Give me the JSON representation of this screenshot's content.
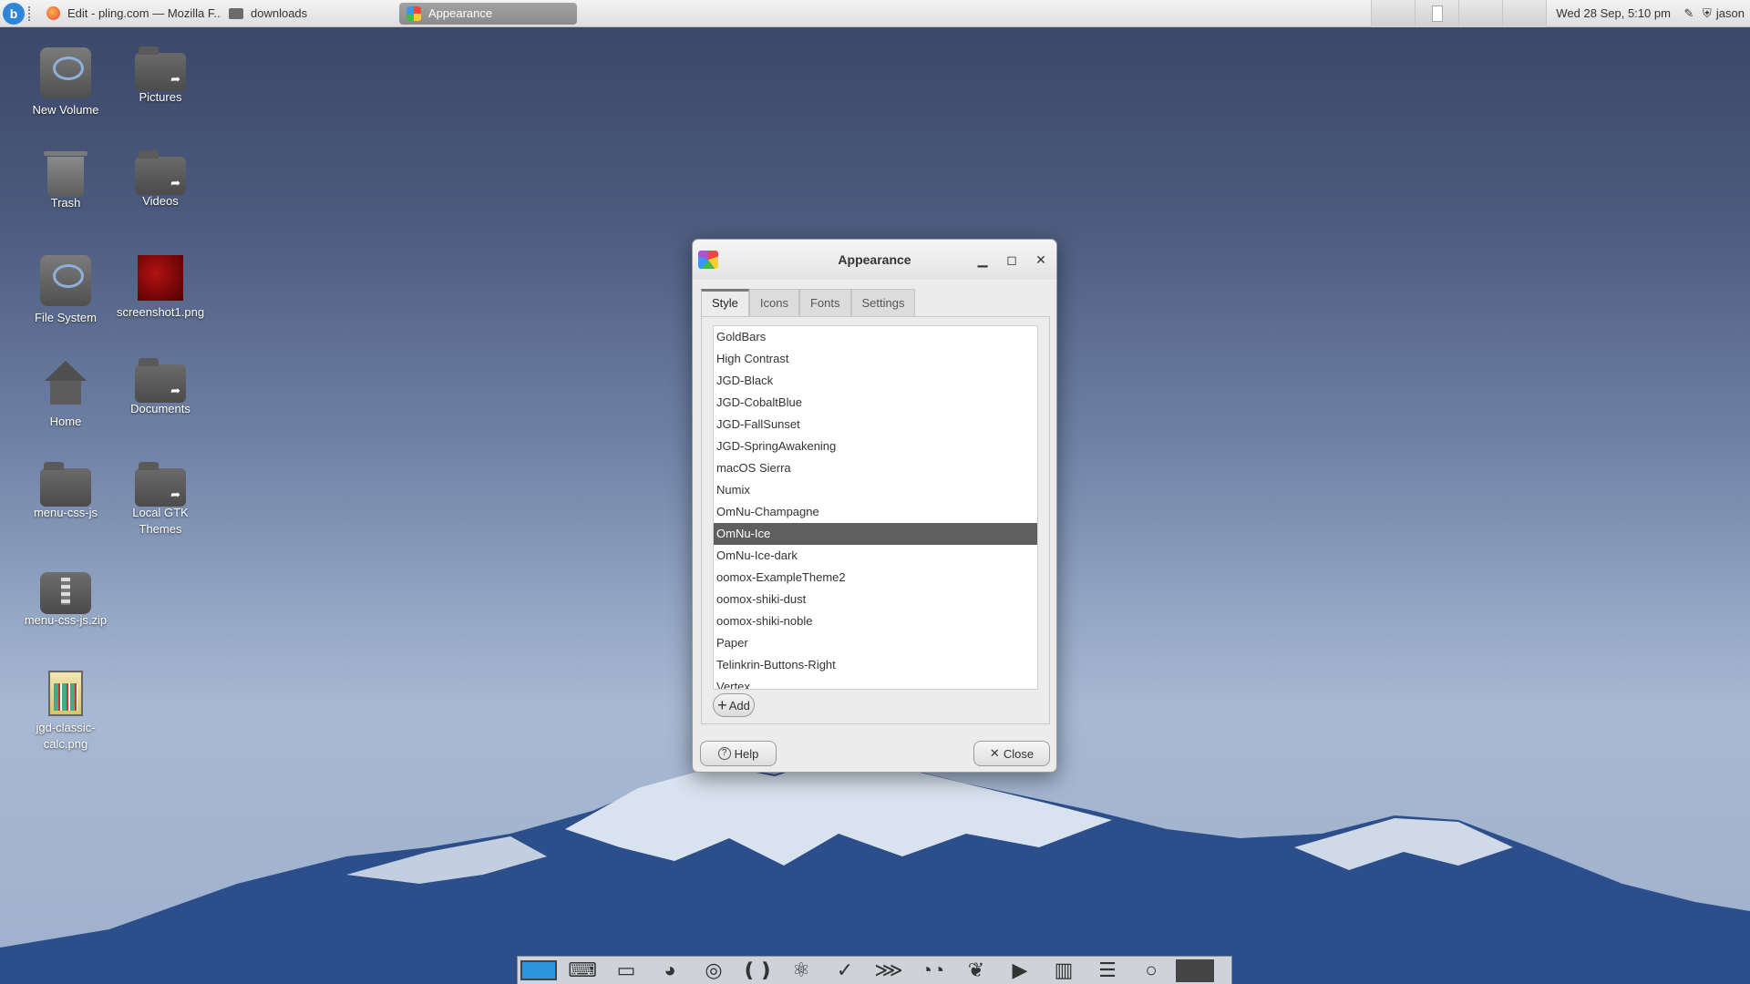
{
  "top_panel": {
    "tasks": [
      {
        "label": "Edit - pling.com — Mozilla F..."
      },
      {
        "label": "downloads"
      },
      {
        "label": "Appearance"
      }
    ],
    "clock": "Wed 28 Sep, 5:10 pm",
    "user": "jason"
  },
  "desktop": {
    "icons": [
      {
        "label": "New Volume",
        "icon": "drive-icon"
      },
      {
        "label": "Pictures",
        "icon": "folder-link-icon"
      },
      {
        "label": "Trash",
        "icon": "trash-icon"
      },
      {
        "label": "Videos",
        "icon": "folder-link-icon"
      },
      {
        "label": "File System",
        "icon": "drive-icon"
      },
      {
        "label": "screenshot1.png",
        "icon": "image-icon"
      },
      {
        "label": "Home",
        "icon": "home-icon"
      },
      {
        "label": "Documents",
        "icon": "folder-link-icon"
      },
      {
        "label": "menu-css-js",
        "icon": "folder-icon"
      },
      {
        "label": "Local GTK Themes",
        "icon": "folder-link-icon"
      },
      {
        "label": "menu-css-js.zip",
        "icon": "archive-icon"
      },
      {
        "label": "jgd-classic-calc.png",
        "icon": "image-icon"
      }
    ]
  },
  "dialog": {
    "title": "Appearance",
    "tabs": [
      "Style",
      "Icons",
      "Fonts",
      "Settings"
    ],
    "selected_tab": "Style",
    "themes": [
      "GoldBars",
      "High Contrast",
      "JGD-Black",
      "JGD-CobaltBlue",
      "JGD-FallSunset",
      "JGD-SpringAwakening",
      "macOS Sierra",
      "Numix",
      "OmNu-Champagne",
      "OmNu-Ice",
      "OmNu-Ice-dark",
      "oomox-ExampleTheme2",
      "oomox-shiki-dust",
      "oomox-shiki-noble",
      "Paper",
      "Telinkrin-Buttons-Right",
      "Vertex"
    ],
    "selected_theme": "OmNu-Ice",
    "add_label": "Add",
    "help_label": "Help",
    "close_label": "Close"
  },
  "colors": {
    "selection": "#5f5f5f",
    "accent": "#2d95e0"
  }
}
